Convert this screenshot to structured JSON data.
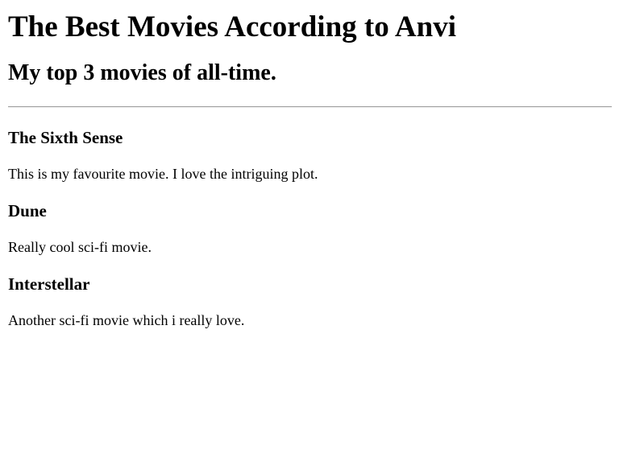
{
  "header": {
    "title": "The Best Movies According to Anvi",
    "subtitle": "My top 3 movies of all-time."
  },
  "movies": [
    {
      "title": "The Sixth Sense",
      "description": "This is my favourite movie. I love the intriguing plot."
    },
    {
      "title": "Dune",
      "description": "Really cool sci-fi movie."
    },
    {
      "title": "Interstellar",
      "description": "Another sci-fi movie which i really love."
    }
  ]
}
